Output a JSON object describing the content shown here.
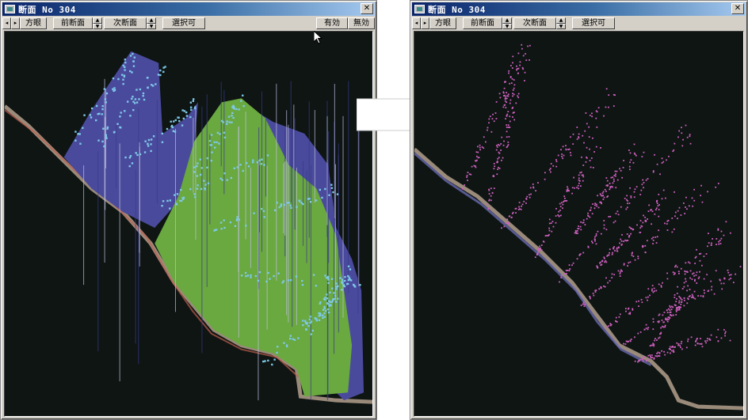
{
  "left_window": {
    "title": "断面 No  304",
    "close_label": "✕",
    "toolbar": {
      "prev_arrow": "◂",
      "next_arrow": "▸",
      "view_label": "方眼",
      "prev_section_label": "前断面",
      "next_section_label": "次断面",
      "selectable_label": "選択可",
      "valid_label": "有効",
      "invalid_label": "無効"
    }
  },
  "right_window": {
    "title": "断面 No  304",
    "close_label": "✕",
    "toolbar": {
      "prev_arrow": "◂",
      "next_arrow": "▸",
      "view_label": "方眼",
      "prev_section_label": "前断面",
      "next_section_label": "次断面",
      "selectable_label": "選択可"
    }
  },
  "colors": {
    "viewport_bg": "#0e1513",
    "tree_fill_blue": "#4a4a9c",
    "tree_fill_green": "#6aa840",
    "crown_points": "#7ec8e8",
    "filtered_points": "#d060c0",
    "terrain": "#9a8a7a"
  },
  "icons": [
    "window-icon",
    "close-icon",
    "arrow-left-icon",
    "arrow-right-icon",
    "spin-up-icon",
    "spin-down-icon",
    "mouse-cursor-icon",
    "transition-arrow-icon"
  ]
}
